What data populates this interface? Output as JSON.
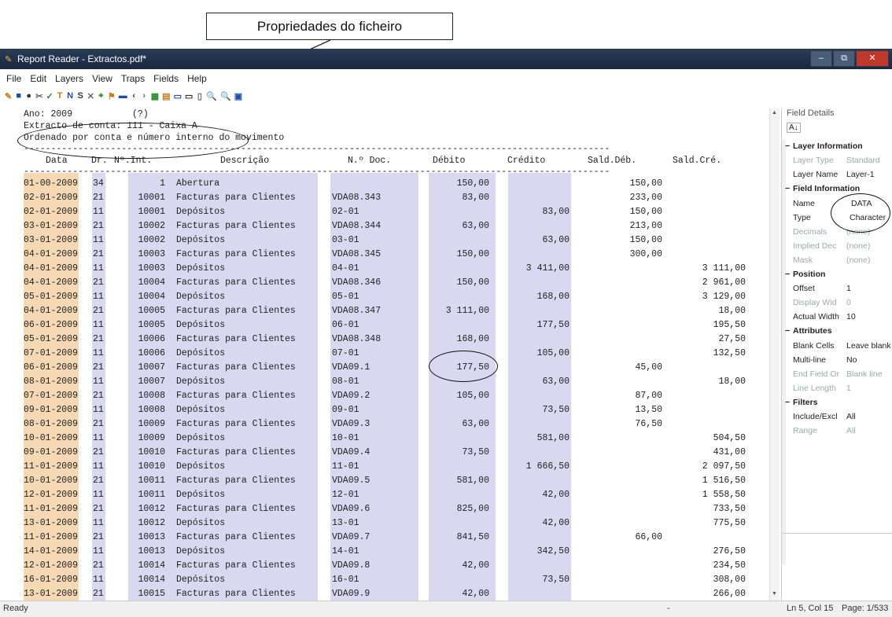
{
  "callout": {
    "label": "Propriedades do ficheiro"
  },
  "window": {
    "title": "Report Reader - Extractos.pdf*",
    "minimize": "–",
    "maximize": "⧉",
    "close": "✕"
  },
  "menu": [
    "File",
    "Edit",
    "Layers",
    "View",
    "Traps",
    "Fields",
    "Help"
  ],
  "toolbar_icons": [
    "new-icon",
    "save-icon",
    "open-icon",
    "cut-icon",
    "check-icon",
    "text-icon",
    "numeric-icon",
    "skip-icon",
    "clear-icon",
    "filter-icon",
    "edit-icon",
    "field-properties-icon",
    "undo-icon",
    "redo-icon",
    "file-properties-icon",
    "layers-icon",
    "options-icon",
    "grid-icon",
    "zoom-in-icon",
    "zoom-out-icon",
    "fit-icon",
    "window-icon"
  ],
  "toolbar_glyphs": [
    "✎",
    "■",
    "●",
    "✂",
    "✓",
    "T",
    "N",
    "S",
    "✕",
    "⌖",
    "⚑",
    "▬",
    "‹",
    "›",
    "▦",
    "▤",
    "▭",
    "▭",
    "▯",
    "🔍",
    "🔍",
    "▣",
    "▤"
  ],
  "report": {
    "header_line1": "Ano: 2009           (?)",
    "header_line2": "Extracto de conta: 111 - Caixa A",
    "header_line3": "Ordenado por conta e número interno do movimento",
    "dashes": "------------------------------------------------------------------------------------------------------------",
    "col_data": "Data",
    "col_dr": "Dr.",
    "col_nint": "Nº.Int.",
    "col_desc": "Descrição",
    "col_ndoc": "N.º Doc.",
    "col_debito": "Débito",
    "col_credito": "Crédito",
    "col_salddeb": "Sald.Déb.",
    "col_saldcre": "Sald.Cré.",
    "rows": [
      [
        "01-00-2009",
        "34",
        "1",
        "Abertura",
        "",
        "150,00",
        "",
        "150,00",
        ""
      ],
      [
        "02-01-2009",
        "21",
        "10001",
        "Facturas para Clientes",
        "VDA08.343",
        "83,00",
        "",
        "233,00",
        ""
      ],
      [
        "02-01-2009",
        "11",
        "10001",
        "Depósitos",
        "02-01",
        "",
        "83,00",
        "150,00",
        ""
      ],
      [
        "03-01-2009",
        "21",
        "10002",
        "Facturas para Clientes",
        "VDA08.344",
        "63,00",
        "",
        "213,00",
        ""
      ],
      [
        "03-01-2009",
        "11",
        "10002",
        "Depósitos",
        "03-01",
        "",
        "63,00",
        "150,00",
        ""
      ],
      [
        "04-01-2009",
        "21",
        "10003",
        "Facturas para Clientes",
        "VDA08.345",
        "150,00",
        "",
        "300,00",
        ""
      ],
      [
        "04-01-2009",
        "11",
        "10003",
        "Depósitos",
        "04-01",
        "",
        "3 411,00",
        "",
        "3 111,00"
      ],
      [
        "04-01-2009",
        "21",
        "10004",
        "Facturas para Clientes",
        "VDA08.346",
        "150,00",
        "",
        "",
        "2 961,00"
      ],
      [
        "05-01-2009",
        "11",
        "10004",
        "Depósitos",
        "05-01",
        "",
        "168,00",
        "",
        "3 129,00"
      ],
      [
        "04-01-2009",
        "21",
        "10005",
        "Facturas para Clientes",
        "VDA08.347",
        "3 111,00",
        "",
        "",
        "18,00"
      ],
      [
        "06-01-2009",
        "11",
        "10005",
        "Depósitos",
        "06-01",
        "",
        "177,50",
        "",
        "195,50"
      ],
      [
        "05-01-2009",
        "21",
        "10006",
        "Facturas para Clientes",
        "VDA08.348",
        "168,00",
        "",
        "",
        "27,50"
      ],
      [
        "07-01-2009",
        "11",
        "10006",
        "Depósitos",
        "07-01",
        "",
        "105,00",
        "",
        "132,50"
      ],
      [
        "06-01-2009",
        "21",
        "10007",
        "Facturas para Clientes",
        "VDA09.1",
        "177,50",
        "",
        "45,00",
        ""
      ],
      [
        "08-01-2009",
        "11",
        "10007",
        "Depósitos",
        "08-01",
        "",
        "63,00",
        "",
        "18,00"
      ],
      [
        "07-01-2009",
        "21",
        "10008",
        "Facturas para Clientes",
        "VDA09.2",
        "105,00",
        "",
        "87,00",
        ""
      ],
      [
        "09-01-2009",
        "11",
        "10008",
        "Depósitos",
        "09-01",
        "",
        "73,50",
        "13,50",
        ""
      ],
      [
        "08-01-2009",
        "21",
        "10009",
        "Facturas para Clientes",
        "VDA09.3",
        "63,00",
        "",
        "76,50",
        ""
      ],
      [
        "10-01-2009",
        "11",
        "10009",
        "Depósitos",
        "10-01",
        "",
        "581,00",
        "",
        "504,50"
      ],
      [
        "09-01-2009",
        "21",
        "10010",
        "Facturas para Clientes",
        "VDA09.4",
        "73,50",
        "",
        "",
        "431,00"
      ],
      [
        "11-01-2009",
        "11",
        "10010",
        "Depósitos",
        "11-01",
        "",
        "1 666,50",
        "",
        "2 097,50"
      ],
      [
        "10-01-2009",
        "21",
        "10011",
        "Facturas para Clientes",
        "VDA09.5",
        "581,00",
        "",
        "",
        "1 516,50"
      ],
      [
        "12-01-2009",
        "11",
        "10011",
        "Depósitos",
        "12-01",
        "",
        "42,00",
        "",
        "1 558,50"
      ],
      [
        "11-01-2009",
        "21",
        "10012",
        "Facturas para Clientes",
        "VDA09.6",
        "825,00",
        "",
        "",
        "733,50"
      ],
      [
        "13-01-2009",
        "11",
        "10012",
        "Depósitos",
        "13-01",
        "",
        "42,00",
        "",
        "775,50"
      ],
      [
        "11-01-2009",
        "21",
        "10013",
        "Facturas para Clientes",
        "VDA09.7",
        "841,50",
        "",
        "66,00",
        ""
      ],
      [
        "14-01-2009",
        "11",
        "10013",
        "Depósitos",
        "14-01",
        "",
        "342,50",
        "",
        "276,50"
      ],
      [
        "12-01-2009",
        "21",
        "10014",
        "Facturas para Clientes",
        "VDA09.8",
        "42,00",
        "",
        "",
        "234,50"
      ],
      [
        "16-01-2009",
        "11",
        "10014",
        "Depósitos",
        "16-01",
        "",
        "73,50",
        "",
        "308,00"
      ],
      [
        "13-01-2009",
        "21",
        "10015",
        "Facturas para Clientes",
        "VDA09.9",
        "42,00",
        "",
        "",
        "266,00"
      ]
    ]
  },
  "panel": {
    "title": "Field Details",
    "sort_label": "A↓",
    "layer_info": "Layer Information",
    "layer_type_label": "Layer Type",
    "layer_type_value": "Standard",
    "layer_name_label": "Layer Name",
    "layer_name_value": "Layer-1",
    "field_info": "Field Information",
    "name_label": "Name",
    "name_value": "DATA",
    "type_label": "Type",
    "type_value": "Character",
    "decimals_label": "Decimals",
    "decimals_value": "(none)",
    "implied_label": "Implied Dec",
    "implied_value": "(none)",
    "mask_label": "Mask",
    "mask_value": "(none)",
    "position": "Position",
    "offset_label": "Offset",
    "offset_value": "1",
    "display_label": "Display Wid",
    "display_value": "0",
    "actual_label": "Actual Width",
    "actual_value": "10",
    "attributes": "Attributes",
    "blank_label": "Blank Cells",
    "blank_value": "Leave blank",
    "multiline_label": "Multi-line",
    "multiline_value": "No",
    "endfield_label": "End Field Or",
    "endfield_value": "Blank line",
    "linelen_label": "Line Length",
    "linelen_value": "1",
    "filters": "Filters",
    "include_label": "Include/Excl",
    "include_value": "All",
    "range_label": "Range",
    "range_value": "All"
  },
  "status": {
    "left": "Ready",
    "dash": "-",
    "position": "Ln 5, Col 15",
    "page": "Page: 1/533"
  },
  "colors": {
    "date_shade": "#f6d9b4",
    "blue_shade": "#d8d9f0",
    "title_bar": "#1f2f48"
  }
}
